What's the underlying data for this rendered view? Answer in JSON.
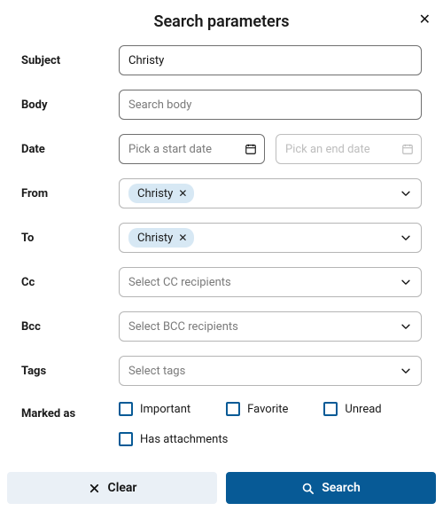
{
  "title": "Search parameters",
  "labels": {
    "subject": "Subject",
    "body": "Body",
    "date": "Date",
    "from": "From",
    "to": "To",
    "cc": "Cc",
    "bcc": "Bcc",
    "tags": "Tags",
    "marked_as": "Marked as"
  },
  "subject": {
    "value": "Christy"
  },
  "body": {
    "placeholder": "Search body"
  },
  "date": {
    "start_placeholder": "Pick a start date",
    "end_placeholder": "Pick an end date"
  },
  "from": {
    "chip0": "Christy"
  },
  "to": {
    "chip0": "Christy"
  },
  "cc": {
    "placeholder": "Select CC recipients"
  },
  "bcc": {
    "placeholder": "Select BCC recipients"
  },
  "tags": {
    "placeholder": "Select tags"
  },
  "checks": {
    "important": "Important",
    "favorite": "Favorite",
    "unread": "Unread",
    "has_attachments": "Has attachments"
  },
  "buttons": {
    "clear": "Clear",
    "search": "Search"
  }
}
